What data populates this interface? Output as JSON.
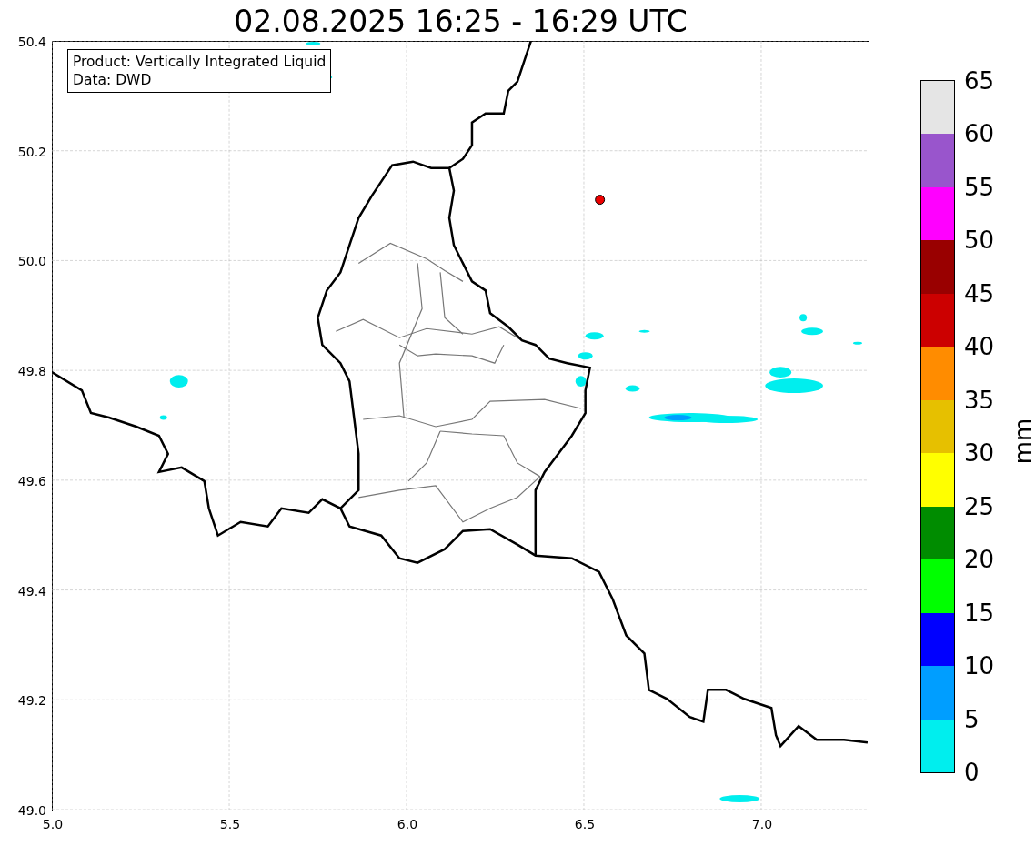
{
  "title": "02.08.2025 16:25 - 16:29 UTC",
  "info_box": [
    "Product: Vertically Integrated Liquid",
    "Data: DWD"
  ],
  "map": {
    "y_ticks": [
      "50.4",
      "50.2",
      "50.0",
      "49.8",
      "49.6",
      "49.4",
      "49.2",
      "49.0"
    ],
    "x_ticks": [
      "5.0",
      "5.5",
      "6.0",
      "6.5",
      "7.0"
    ]
  },
  "colorbar": {
    "label": "mm",
    "segments": [
      {
        "color": "#e5e5e5"
      },
      {
        "color": "#9955cc"
      },
      {
        "color": "#ff00ff"
      },
      {
        "color": "#990000"
      },
      {
        "color": "#cc0000"
      },
      {
        "color": "#ff8c00"
      },
      {
        "color": "#e6c000"
      },
      {
        "color": "#ffff00"
      },
      {
        "color": "#008c00"
      },
      {
        "color": "#00ff00"
      },
      {
        "color": "#0000ff"
      },
      {
        "color": "#009eff"
      },
      {
        "color": "#00eeee"
      }
    ],
    "ticks": [
      "65",
      "60",
      "55",
      "50",
      "45",
      "40",
      "35",
      "30",
      "25",
      "20",
      "15",
      "10",
      "5",
      "0"
    ]
  }
}
